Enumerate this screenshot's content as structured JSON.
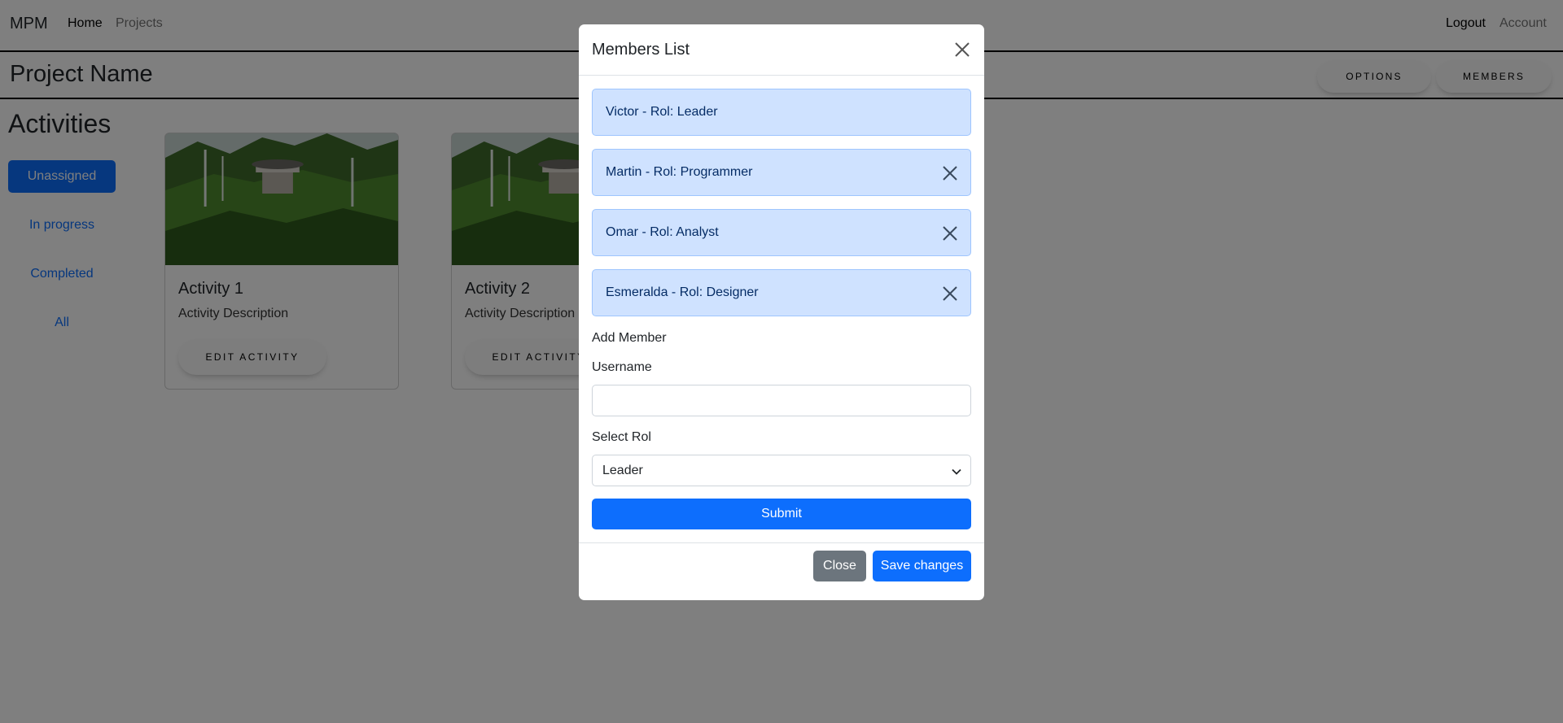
{
  "navbar": {
    "brand": "MPM",
    "links": [
      {
        "label": "Home"
      },
      {
        "label": "Projects"
      }
    ],
    "right_links": [
      {
        "label": "Logout"
      },
      {
        "label": "Account"
      }
    ]
  },
  "project": {
    "title": "Project Name",
    "buttons": [
      {
        "label": "Options"
      },
      {
        "label": "Members"
      }
    ]
  },
  "activities": {
    "title": "Activities",
    "filters": [
      {
        "label": "Unassigned",
        "active": true
      },
      {
        "label": "In progress",
        "active": false
      },
      {
        "label": "Completed",
        "active": false
      },
      {
        "label": "All",
        "active": false
      }
    ],
    "cards": [
      {
        "title": "Activity 1",
        "description": "Activity Description",
        "button": "Edit Activity"
      },
      {
        "title": "Activity 2",
        "description": "Activity Description",
        "button": "Edit Activity"
      }
    ]
  },
  "modal": {
    "title": "Members List",
    "close_icon": "close-icon",
    "members": [
      {
        "label": "Victor - Rol: Leader",
        "removable": false
      },
      {
        "label": "Martin - Rol: Programmer",
        "removable": true
      },
      {
        "label": "Omar - Rol: Analyst",
        "removable": true
      },
      {
        "label": "Esmeralda - Rol: Designer",
        "removable": true
      }
    ],
    "add_member_heading": "Add Member",
    "username_label": "Username",
    "username_value": "",
    "role_label": "Select Rol",
    "role_selected": "Leader",
    "submit_label": "Submit",
    "footer": {
      "close_label": "Close",
      "save_label": "Save changes"
    }
  },
  "colors": {
    "primary": "#0d6efd",
    "secondary": "#6c757d",
    "member_bg": "#cfe2ff",
    "member_text": "#052c65",
    "backdrop": "rgba(0,0,0,0.5)"
  }
}
